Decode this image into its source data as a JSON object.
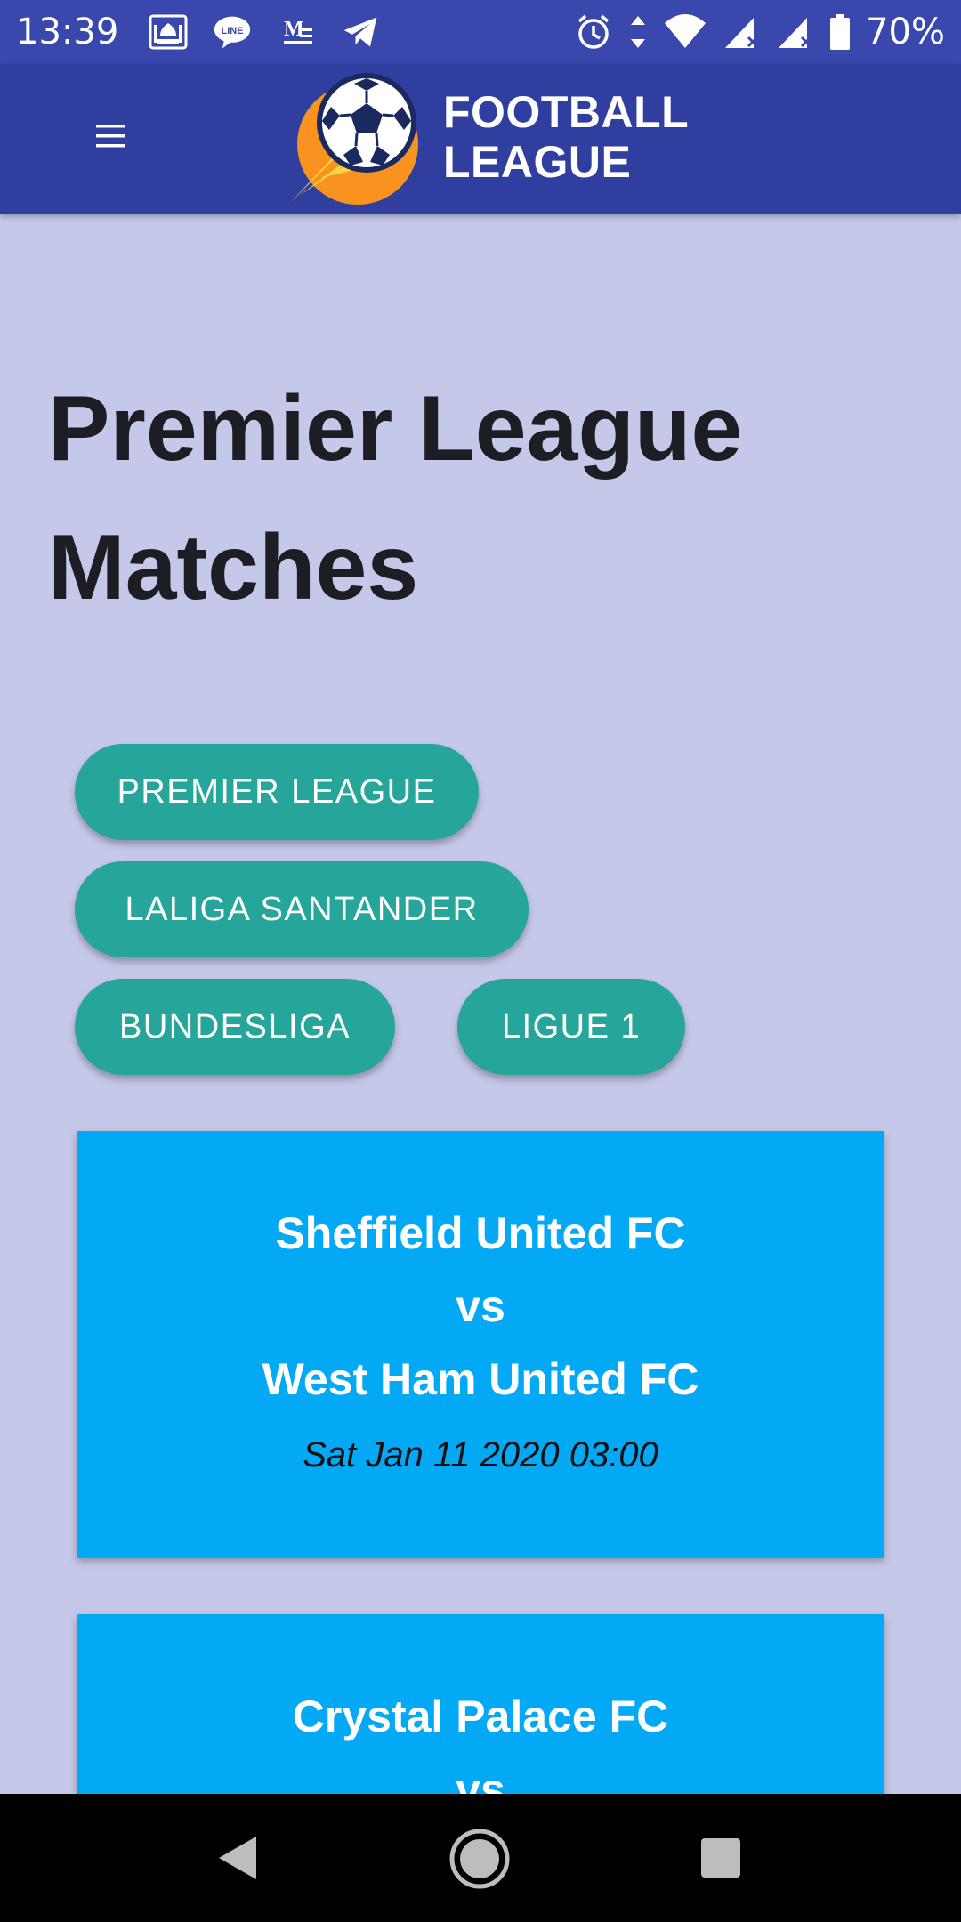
{
  "status_bar": {
    "time": "13:39",
    "battery": "70%",
    "left_icons": [
      "mosque-icon",
      "line-icon",
      "gmail-icon",
      "telegram-icon"
    ],
    "right_icons": [
      "alarm-icon",
      "data-arrows-icon",
      "wifi-icon",
      "signal-icon",
      "signal-icon",
      "battery-icon"
    ]
  },
  "app_bar": {
    "brand_line1": "FOOTBALL",
    "brand_line2": "LEAGUE",
    "menu_icon": "hamburger-menu-icon",
    "logo_icon": "soccer-ball-logo-icon",
    "color": "#303f9f"
  },
  "page": {
    "title_line1": "Premier League",
    "title_line2": "Matches",
    "background": "#c5c8e8"
  },
  "leagues": [
    {
      "label": "PREMIER LEAGUE"
    },
    {
      "label": "LALIGA SANTANDER"
    },
    {
      "label": "BUNDESLIGA"
    },
    {
      "label": "LIGUE 1"
    }
  ],
  "league_button_color": "#26a69a",
  "matches": [
    {
      "home": "Sheffield United FC",
      "vs": "vs",
      "away": "West Ham United FC",
      "date": "Sat Jan 11 2020 03:00"
    },
    {
      "home": "Crystal Palace FC",
      "vs": "vs",
      "away": "",
      "date": ""
    }
  ],
  "match_card_color": "#03a9f4",
  "nav_bar": {
    "icons": [
      "back-triangle-icon",
      "home-circle-icon",
      "recents-square-icon"
    ]
  }
}
